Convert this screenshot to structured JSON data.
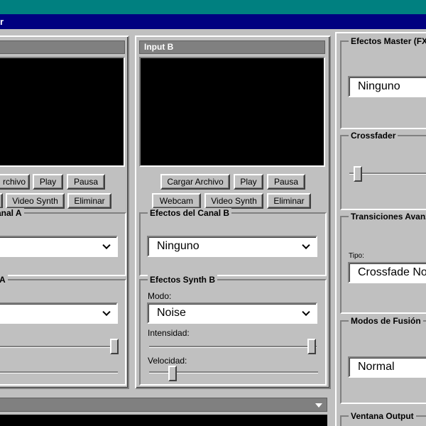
{
  "window": {
    "title_fragment": "r"
  },
  "input_a": {
    "buttons_row1": [
      "rchivo",
      "Play",
      "Pausa"
    ],
    "buttons_row2": [
      "Video Synth",
      "Eliminar"
    ],
    "effects_title": "anal A",
    "synth_title": "A"
  },
  "input_b": {
    "header": "Input B",
    "buttons_row1": [
      "Cargar Archivo",
      "Play",
      "Pausa"
    ],
    "buttons_row2": [
      "Webcam",
      "Video Synth",
      "Eliminar"
    ],
    "effects_title": "Efectos del Canal B",
    "effects_value": "Ninguno",
    "synth_title": "Efectos Synth B",
    "mode_label": "Modo:",
    "mode_value": "Noise",
    "intensity_label": "Intensidad:",
    "intensity_level": 0.98,
    "speed_label": "Velocidad:",
    "speed_level": 0.12
  },
  "input_a_levels": {
    "slider1_level": 0.98,
    "slider2_level": 0.0
  },
  "master": {
    "fx_title": "Efectos Master (FX)",
    "fx_value": "Ninguno",
    "crossfader_title": "Crossfader",
    "crossfader_level": 0.05,
    "transitions_title": "Transiciones Avanza",
    "type_label": "Tipo:",
    "type_value": "Crossfade No",
    "blend_title": "Modos de Fusión",
    "blend_value": "Normal",
    "output_title": "Ventana Output"
  }
}
